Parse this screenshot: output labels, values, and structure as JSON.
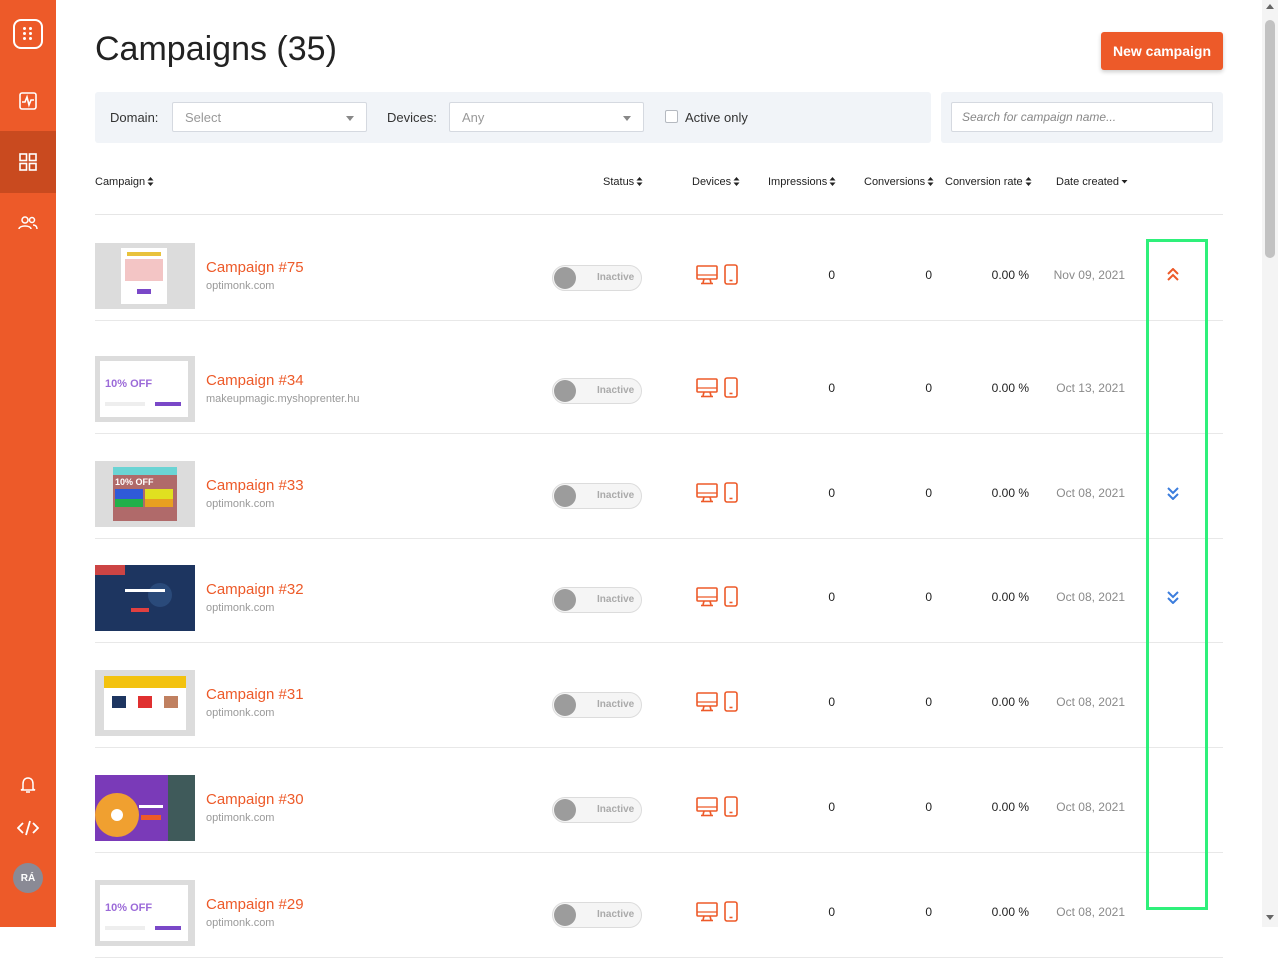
{
  "colors": {
    "brand": "#ed5a29",
    "sidebar_active": "#c94a1f",
    "highlight": "#2ef07a",
    "arrow_down": "#3b7ddd"
  },
  "sidebar": {
    "items": [
      {
        "name": "analytics-icon"
      },
      {
        "name": "campaigns-grid-icon",
        "active": true
      },
      {
        "name": "users-icon"
      }
    ],
    "bottom": [
      {
        "name": "bell-icon"
      },
      {
        "name": "code-icon"
      }
    ],
    "avatar_initials": "RÁ"
  },
  "header": {
    "title": "Campaigns (35)",
    "new_button": "New campaign"
  },
  "filters": {
    "domain_label": "Domain:",
    "domain_value": "Select",
    "devices_label": "Devices:",
    "devices_value": "Any",
    "active_only_label": "Active only",
    "active_only_checked": false,
    "search_placeholder": "Search for campaign name..."
  },
  "table": {
    "columns": [
      "Campaign",
      "Status",
      "Devices",
      "Impressions",
      "Conversions",
      "Conversion rate",
      "Date created"
    ],
    "sorted_column": "Date created",
    "rows": [
      {
        "name": "Campaign #75",
        "domain": "optimonk.com",
        "status": "Inactive",
        "impressions": "0",
        "conversions": "0",
        "rate": "0.00 %",
        "date": "Nov 09, 2021",
        "arrow": "up"
      },
      {
        "name": "Campaign #34",
        "domain": "makeupmagic.myshoprenter.hu",
        "status": "Inactive",
        "impressions": "0",
        "conversions": "0",
        "rate": "0.00 %",
        "date": "Oct 13, 2021",
        "arrow": ""
      },
      {
        "name": "Campaign #33",
        "domain": "optimonk.com",
        "status": "Inactive",
        "impressions": "0",
        "conversions": "0",
        "rate": "0.00 %",
        "date": "Oct 08, 2021",
        "arrow": "down"
      },
      {
        "name": "Campaign #32",
        "domain": "optimonk.com",
        "status": "Inactive",
        "impressions": "0",
        "conversions": "0",
        "rate": "0.00 %",
        "date": "Oct 08, 2021",
        "arrow": "down"
      },
      {
        "name": "Campaign #31",
        "domain": "optimonk.com",
        "status": "Inactive",
        "impressions": "0",
        "conversions": "0",
        "rate": "0.00 %",
        "date": "Oct 08, 2021",
        "arrow": ""
      },
      {
        "name": "Campaign #30",
        "domain": "optimonk.com",
        "status": "Inactive",
        "impressions": "0",
        "conversions": "0",
        "rate": "0.00 %",
        "date": "Oct 08, 2021",
        "arrow": ""
      },
      {
        "name": "Campaign #29",
        "domain": "optimonk.com",
        "status": "Inactive",
        "impressions": "0",
        "conversions": "0",
        "rate": "0.00 %",
        "date": "Oct 08, 2021",
        "arrow": ""
      }
    ]
  }
}
